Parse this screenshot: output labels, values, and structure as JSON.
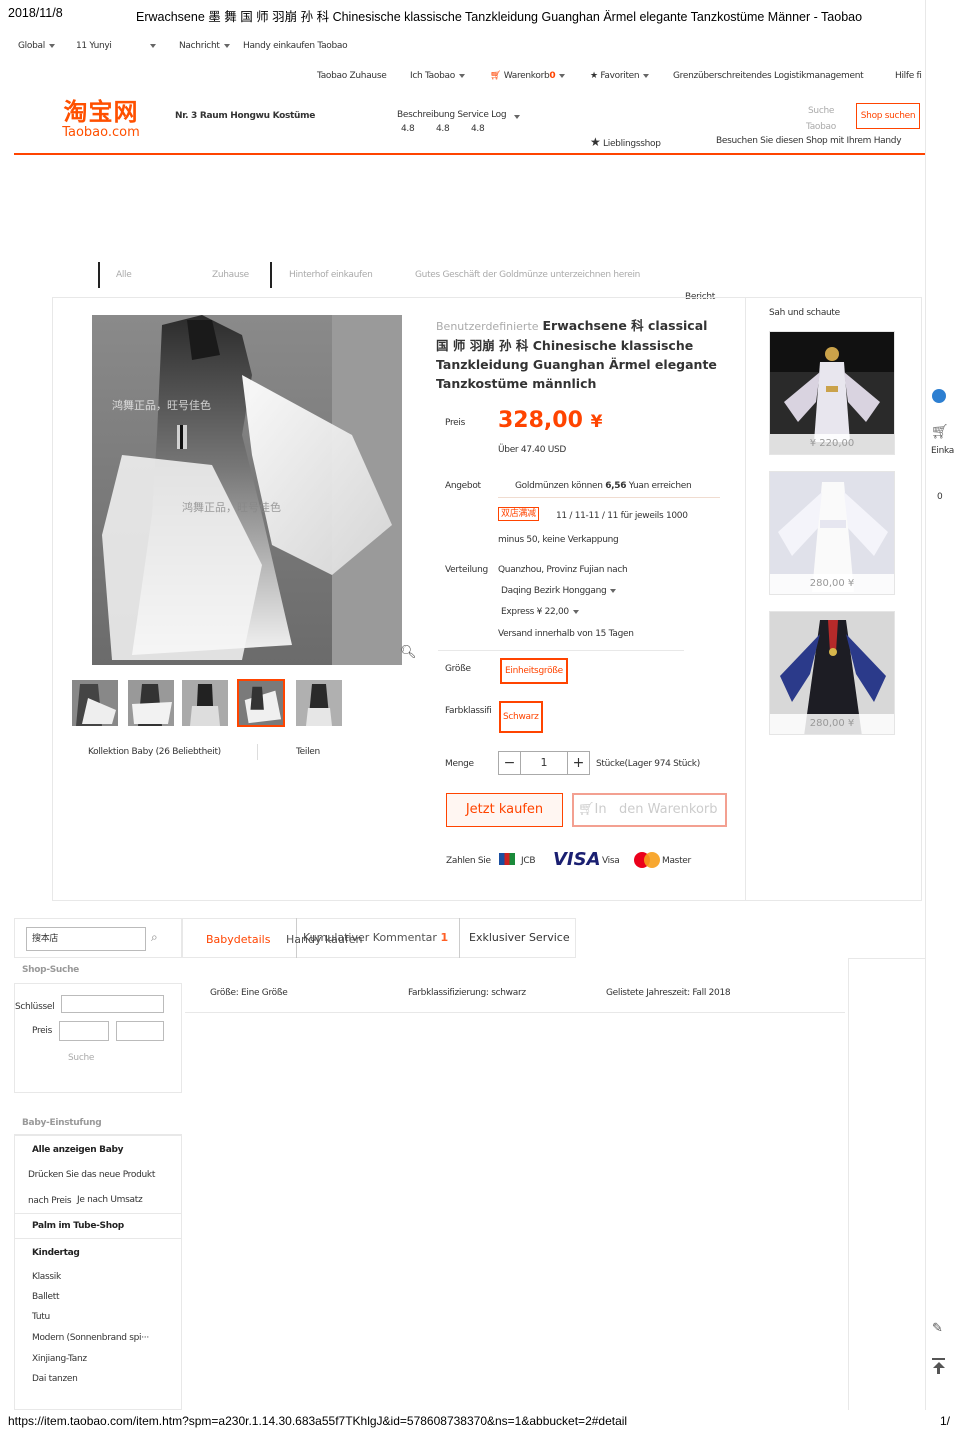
{
  "print_header": {
    "date": "2018/11/8",
    "page_title": "Erwachsene 墨 舞 国 师 羽崩 孙 科 Chinesische klassische Tanzkleidung Guanghan Ärmel elegante Tanzkostüme Männer - Taobao"
  },
  "print_footer": {
    "url": "https://item.taobao.com/item.htm?spm=a230r.1.14.30.683a55f7TKhlgJ&id=578608738370&ns=1&abbucket=2#detail",
    "page": "1/"
  },
  "topbar": {
    "region": "Global",
    "user": "11 Yunyi",
    "messages": "Nachricht",
    "mobile": "Handy einkaufen Taobao"
  },
  "nav": {
    "home": "Taobao Zuhause",
    "my_taobao": "Ich Taobao",
    "cart": "Warenkorb",
    "cart_count": "0",
    "favorites": "Favoriten",
    "logistics": "Grenzüberschreitendes Logistikmanagement",
    "help": "Hilfe fi"
  },
  "header": {
    "logo_cn": "淘宝网",
    "logo_en": "Taobao.com",
    "shop_name": "Nr. 3 Raum Hongwu Kostüme",
    "ratings_labels": "Beschreibung Service Logistik",
    "r1": "4.8",
    "r2": "4.8",
    "r3": "4.8",
    "search_label": "Suche",
    "search_label2": "Taobao",
    "shop_search_btn": "Shop suchen",
    "fav_shop": "Lieblingsshop",
    "mobile_visit": "Besuchen Sie diesen Shop mit Ihrem Handy"
  },
  "shopnav": {
    "all": "Alle",
    "home": "Zuhause",
    "backyard": "Hinterhof einkaufen",
    "goldcoin": "Gutes Geschäft der Goldmünze unterzeichnen herein",
    "report": "Bericht"
  },
  "product": {
    "title_prefix": "Benutzerdefinierte",
    "title_line1": "Erwachsene 科 classical",
    "title_line2": "国 师 羽崩 孙 科 Chinesische klassische",
    "title_line3": "Tanzkleidung Guanghan Ärmel elegante",
    "title_line4": "Tanzkostüme männlich",
    "watermark": "鸿舞正品，旺号佳色",
    "watermark2": "鸿舞正品，旺号佳色",
    "price_label": "Preis",
    "price": "328,00",
    "currency": "¥",
    "usd": "Über 47.40 USD",
    "offer_label": "Angebot",
    "offer_text_a": "Goldmünzen können",
    "offer_amount": "6,56",
    "offer_text_b": "Yuan erreichen",
    "promo_tag": "双店满减",
    "promo_line1": "11 / 11-11 / 11 für jeweils 1000",
    "promo_line2": "minus 50, keine Verkappung",
    "dist_label": "Verteilung",
    "dist_line1": "Quanzhou, Provinz Fujian nach",
    "dist_line2": "Daqing Bezirk Honggang",
    "dist_line3": "Express ¥ 22,00",
    "dist_line4": "Versand innerhalb von 15 Tagen",
    "size_label": "Größe",
    "size_value": "Einheitsgröße",
    "color_label": "Farbklassifi",
    "color_value": "Schwarz",
    "qty_label": "Menge",
    "qty_minus": "−",
    "qty_value": "1",
    "qty_plus": "+",
    "stock": "Stücke(Lager 974 Stück)",
    "buy_now": "Jetzt kaufen",
    "add_cart_a": "In",
    "add_cart_b": "den Warenkorb",
    "pay_label": "Zahlen Sie",
    "jcb": "JCB",
    "visa": "VISA",
    "visa_small": "Visa",
    "master": "Master",
    "collection": "Kollektion Baby (26 Beliebtheit)",
    "share": "Teilen"
  },
  "sidebar_seen": {
    "title": "Sah und schaute",
    "items": [
      {
        "price": "¥ 220,00"
      },
      {
        "price": "280,00 ¥"
      },
      {
        "price": "280,00 ¥"
      }
    ]
  },
  "floating": {
    "cart_label": "Einka",
    "count": "0"
  },
  "left_panel": {
    "search_value": "搜本店",
    "shop_search_title": "Shop-Suche",
    "keyword_label": "Schlüssel",
    "price_label": "Preis",
    "search_btn": "Suche",
    "cat_title": "Baby-Einstufung",
    "show_all": "Alle anzeigen Baby",
    "new_products": "Drücken Sie das neue Produkt",
    "by_price": "nach Preis",
    "by_sales": "Je nach Umsatz",
    "palm": "Palm im Tube-Shop",
    "kids": "Kindertag",
    "cats": [
      "Klassik",
      "Ballett",
      "Tutu",
      "Modern (Sonnenbrand spi···",
      "Xinjiang-Tanz",
      "Dai tanzen"
    ]
  },
  "tabs": {
    "details": "Babydetails",
    "reviews_overlap_a": "Handy kaufen",
    "reviews_overlap_b": "Kumulativer Kommentar",
    "review_count": "1",
    "service": "Exklusiver Service"
  },
  "attributes": {
    "a1": "Größe: Eine Größe",
    "a2": "Farbklassifizierung: schwarz",
    "a3": "Gelistete Jahreszeit: Fall 2018"
  },
  "colors": {
    "accent": "#ff4400",
    "brand": "#ff5000"
  }
}
